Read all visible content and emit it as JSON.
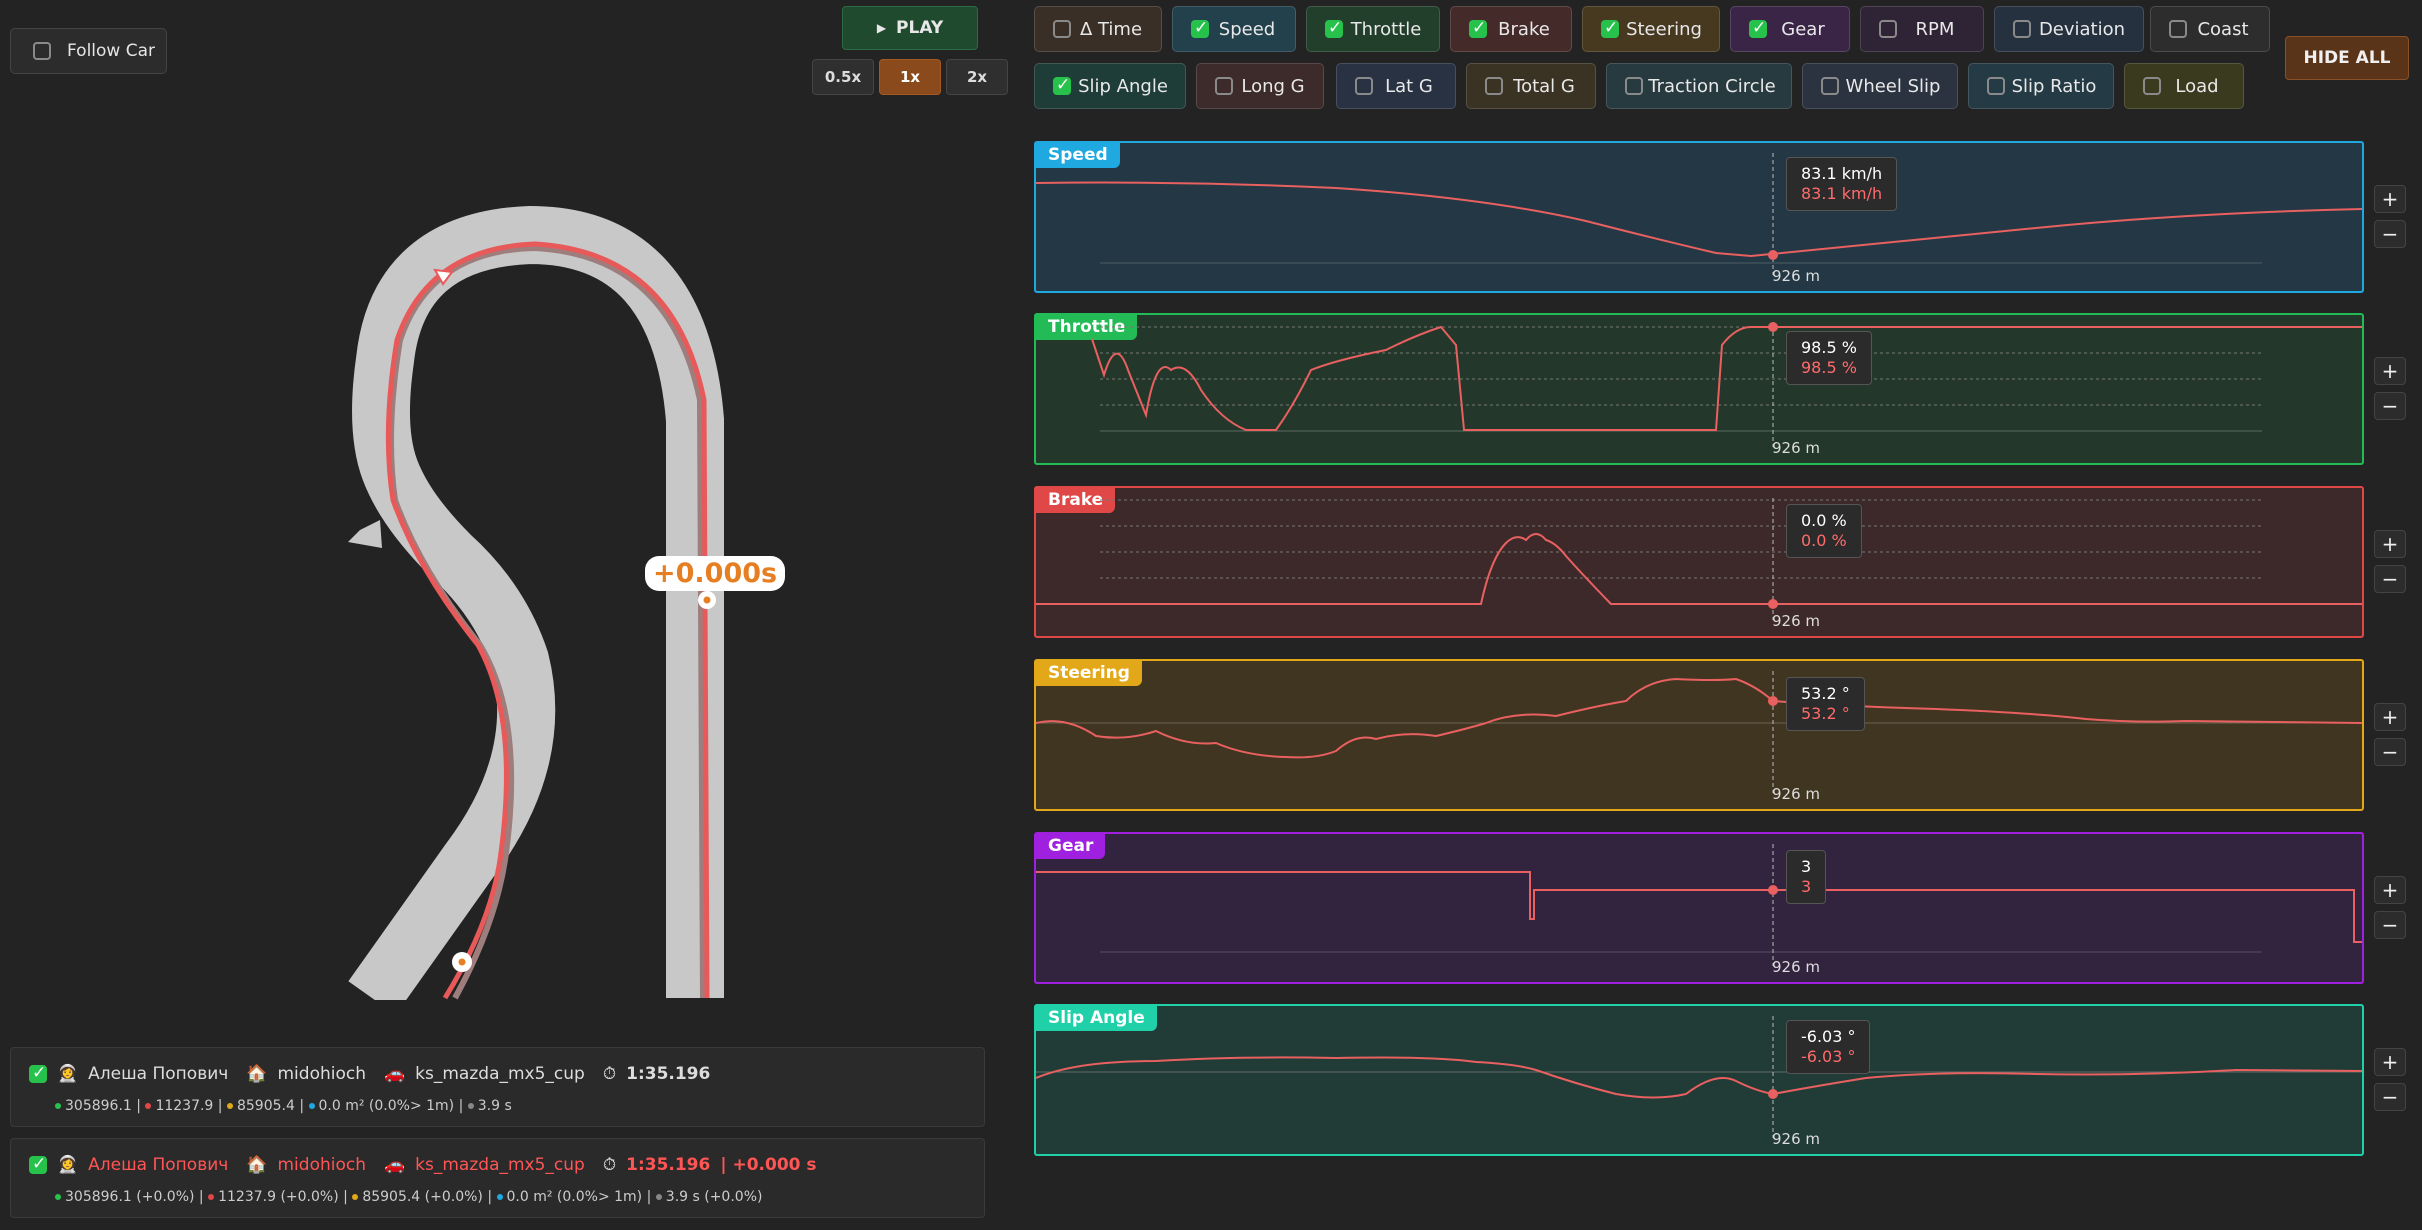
{
  "follow_car": {
    "label": "Follow Car",
    "checked": false
  },
  "playback": {
    "play_label": "PLAY",
    "speeds": [
      "0.5x",
      "1x",
      "2x"
    ],
    "active_speed": "1x"
  },
  "hide_all_label": "HIDE ALL",
  "toggles_row1": [
    {
      "label": "Δ Time",
      "checked": false
    },
    {
      "label": "Speed",
      "checked": true
    },
    {
      "label": "Throttle",
      "checked": true
    },
    {
      "label": "Brake",
      "checked": true
    },
    {
      "label": "Steering",
      "checked": true
    },
    {
      "label": "Gear",
      "checked": true
    },
    {
      "label": "RPM",
      "checked": false
    },
    {
      "label": "Deviation",
      "checked": false
    },
    {
      "label": "Coast",
      "checked": false
    }
  ],
  "toggles_row2": [
    {
      "label": "Slip Angle",
      "checked": true
    },
    {
      "label": "Long G",
      "checked": false
    },
    {
      "label": "Lat G",
      "checked": false
    },
    {
      "label": "Total G",
      "checked": false
    },
    {
      "label": "Traction Circle",
      "checked": false
    },
    {
      "label": "Wheel Slip",
      "checked": false
    },
    {
      "label": "Slip Ratio",
      "checked": false
    },
    {
      "label": "Load",
      "checked": false
    }
  ],
  "map": {
    "delta_label": "+0.000s"
  },
  "panels": [
    {
      "title": "Speed",
      "v1": "83.1 km/h",
      "v2": "83.1 km/h",
      "dist": "926 m"
    },
    {
      "title": "Throttle",
      "v1": "98.5 %",
      "v2": "98.5 %",
      "dist": "926 m"
    },
    {
      "title": "Brake",
      "v1": "0.0 %",
      "v2": "0.0 %",
      "dist": "926 m"
    },
    {
      "title": "Steering",
      "v1": "53.2 °",
      "v2": "53.2 °",
      "dist": "926 m"
    },
    {
      "title": "Gear",
      "v1": "3",
      "v2": "3",
      "dist": "926 m"
    },
    {
      "title": "Slip Angle",
      "v1": "-6.03 °",
      "v2": "-6.03 °",
      "dist": "926 m"
    }
  ],
  "zoom": {
    "plus": "+",
    "minus": "−"
  },
  "laps": [
    {
      "driver": "Алеша Попович",
      "team": "midohioch",
      "car": "ks_mazda_mx5_cup",
      "time": "1:35.196",
      "delta": "",
      "stats": [
        "305896.1",
        "11237.9",
        "85905.4",
        "0.0 m² (0.0%> 1m)",
        "3.9 s"
      ]
    },
    {
      "driver": "Алеша Попович",
      "team": "midohioch",
      "car": "ks_mazda_mx5_cup",
      "time": "1:35.196",
      "delta": "| +0.000 s",
      "stats": [
        "305896.1 (+0.0%)",
        "11237.9 (+0.0%)",
        "85905.4 (+0.0%)",
        "0.0 m² (0.0%> 1m)",
        "3.9 s (+0.0%)"
      ]
    }
  ],
  "colors": {
    "speed": "#1fa9e0",
    "throttle": "#22bb55",
    "brake": "#e04848",
    "steering": "#e3a81a",
    "gear": "#a020e0",
    "slip": "#20d0a8",
    "trace": "#e86060"
  }
}
